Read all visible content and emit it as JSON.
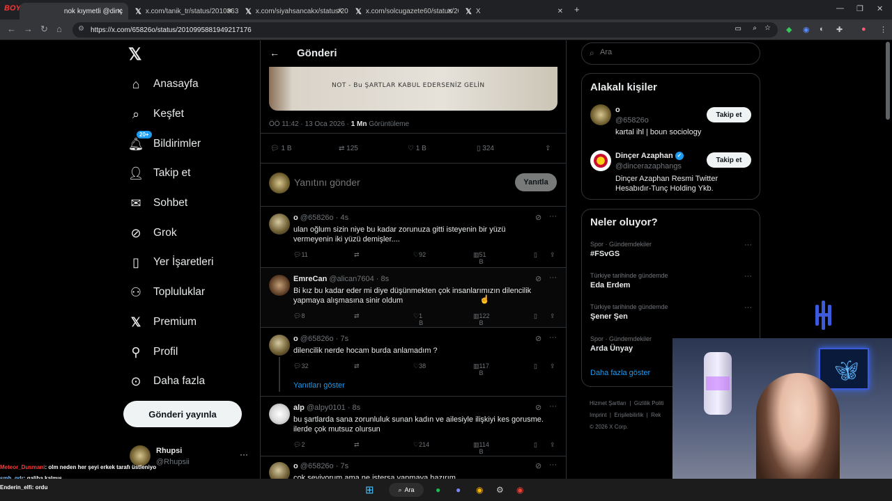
{
  "browser": {
    "tabs": [
      {
        "title": "nok kıymetli @dinç"
      },
      {
        "title": "x.com/tanik_tr/status/20108630"
      },
      {
        "title": "x.com/siyahsancakx/status/201"
      },
      {
        "title": "x.com/solcugazete60/status/20"
      },
      {
        "title": "X"
      }
    ],
    "new_tab": "+",
    "url": "https://x.com/65826o/status/2010995881949217176",
    "watermark": "BOYNOGAME"
  },
  "sidebar": {
    "logo": "𝕏",
    "items": [
      {
        "label": "Anasayfa",
        "icon": "home-icon"
      },
      {
        "label": "Keşfet",
        "icon": "search-icon"
      },
      {
        "label": "Bildirimler",
        "icon": "bell-icon",
        "badge": "20+"
      },
      {
        "label": "Takip et",
        "icon": "person-add-icon"
      },
      {
        "label": "Sohbet",
        "icon": "mail-icon"
      },
      {
        "label": "Grok",
        "icon": "grok-icon"
      },
      {
        "label": "Yer İşaretleri",
        "icon": "bookmark-icon"
      },
      {
        "label": "Topluluklar",
        "icon": "communities-icon"
      },
      {
        "label": "Premium",
        "icon": "x-premium-icon"
      },
      {
        "label": "Profil",
        "icon": "profile-icon"
      },
      {
        "label": "Daha fazla",
        "icon": "more-circle-icon"
      }
    ],
    "post_button": "Gönderi yayınla",
    "account": {
      "name": "Rhupsi",
      "handle": "@Rhupsii",
      "more": "···"
    }
  },
  "main": {
    "header": {
      "back": "←",
      "title": "Gönderi"
    },
    "image_text": "NOT - Bu ŞARTLAR KABUL EDERSENİZ GELİN",
    "meta": {
      "time": "ÖÖ 11:42 · 13 Oca 2026 · ",
      "views_count": "1 Mn",
      "views_label": " Görüntüleme"
    },
    "stats": {
      "replies": "1 B",
      "reposts": "125",
      "likes": "1 B",
      "bookmarks": "324"
    },
    "compose": {
      "placeholder": "Yanıtını gönder",
      "button": "Yanıtla"
    },
    "replies": [
      {
        "name": "o",
        "handle": "@65826o · 4s",
        "text": "ulan oğlum sizin niye bu kadar zorunuza gitti isteyenin bir yüzü vermeyenin iki yüzü demişler....",
        "replies": "11",
        "reposts": "",
        "likes": "92",
        "views": "51 B"
      },
      {
        "name": "EmreCan",
        "handle": "@alican7604 · 8s",
        "text": "Bi kız bu kadar eder mi diye düşünmekten çok insanlarımızın dilencilik yapmaya alışmasına sinir oldum",
        "replies": "8",
        "reposts": "",
        "likes": "1 B",
        "views": "122 B"
      },
      {
        "name": "o",
        "handle": "@65826o · 7s",
        "text": "dilencilik nerde hocam burda anlamadım ?",
        "replies": "32",
        "reposts": "",
        "likes": "38",
        "views": "117 B",
        "show_replies": "Yanıtları göster"
      },
      {
        "name": "alp",
        "handle": "@alpy0101 · 8s",
        "text": "bu şartlarda sana zorunluluk sunan kadın ve ailesiyle ilişkiyi kes gorusme. ilerde çok mutsuz olursun",
        "replies": "2",
        "reposts": "",
        "likes": "214",
        "views": "114 B"
      },
      {
        "name": "o",
        "handle": "@65826o · 7s",
        "text": "çok seviyorum ama ne istersa yapmaya hazırım"
      }
    ]
  },
  "right": {
    "search_placeholder": "Ara",
    "people": {
      "title": "Alakalı kişiler",
      "items": [
        {
          "name": "o",
          "handle": "@65826o",
          "bio": "kartal ihl | boun sociology",
          "button": "Takip et"
        },
        {
          "name": "Dinçer Azaphan",
          "handle": "@dincerazaphangs",
          "bio": "Dinçer Azaphan Resmi Twitter Hesabıdır-Tunç Holding Ykb.",
          "button": "Takip et"
        }
      ]
    },
    "trends": {
      "title": "Neler oluyor?",
      "items": [
        {
          "category": "Spor · Gündemdekiler",
          "title": "#FSvGS"
        },
        {
          "category": "Türkiye tarihinde gündemde",
          "title": "Eda Erdem"
        },
        {
          "category": "Türkiye tarihinde gündemde",
          "title": "Şener Şen"
        },
        {
          "category": "Spor · Gündemdekiler",
          "title": "Arda Ünyay"
        }
      ],
      "show_more": "Daha fazla göster"
    },
    "footer": [
      "Hizmet Şartları",
      "Gizlilik Politi",
      "Imprint",
      "Erişilebilirlik",
      "Rek",
      "© 2026 X Corp."
    ]
  },
  "chat": [
    {
      "user": "Meteor_Dusmani",
      "color": "#ff3b3b",
      "msg": ": olm neden her şeyi erkek tarafı üstleniyo"
    },
    {
      "user": "smh_gdr",
      "color": "#7cc4ff",
      "msg": ": galiba kalmış"
    },
    {
      "user": "Enderin_elfi",
      "color": "#ffffff",
      "msg": ": ordu"
    }
  ],
  "taskbar": {
    "search": "Ara"
  }
}
